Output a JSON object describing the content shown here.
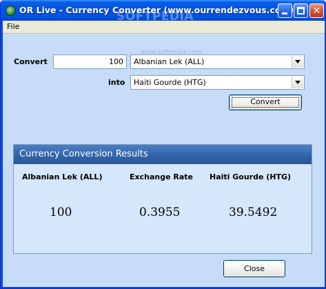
{
  "window": {
    "title": "OR Live - Currency Converter (www.ourrendezvous.com)",
    "watermark": "SOFTPEDIA",
    "watermark_sub": "www.softpedia.com",
    "controls": {
      "minimize": "minimize",
      "maximize": "maximize",
      "close": "✕"
    }
  },
  "menu": {
    "file": "File"
  },
  "form": {
    "convert_label": "Convert",
    "amount_value": "100",
    "from_currency": "Albanian Lek (ALL)",
    "into_label": "into",
    "to_currency": "Haiti Gourde (HTG)",
    "convert_button": "Convert"
  },
  "results": {
    "title": "Currency Conversion Results",
    "col_from": "Albanian Lek (ALL)",
    "col_rate": "Exchange Rate",
    "col_to": "Haiti Gourde (HTG)",
    "amount": "100",
    "rate": "0.3955",
    "converted": "39.5492"
  },
  "footer": {
    "close_button": "Close"
  },
  "colors": {
    "titlebar": "#0052e0",
    "client_bg": "#c6dcf7",
    "results_header": "#2f63a8",
    "results_bg": "#d6e6fb"
  }
}
